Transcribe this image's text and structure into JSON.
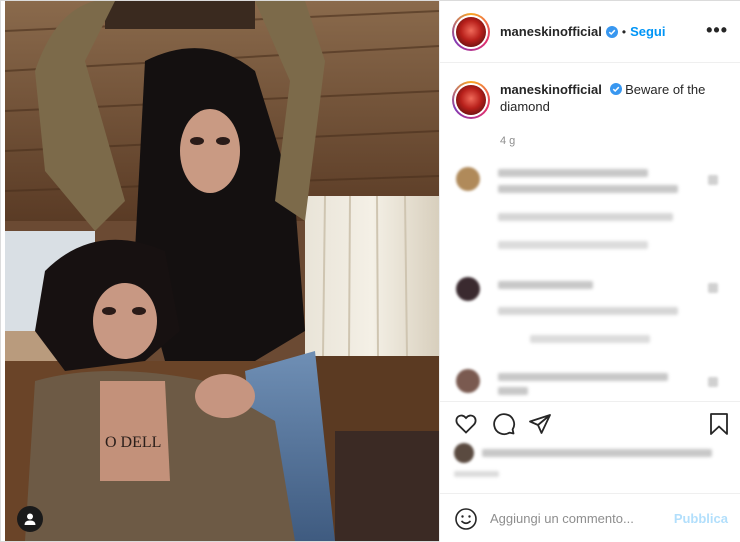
{
  "post": {
    "username": "maneskinofficial",
    "follow_label": "Segui",
    "more_label": "•••",
    "separator": "•"
  },
  "caption": {
    "username": "maneskinofficial",
    "text": "Beware of the diamond",
    "time": "4 g"
  },
  "comment_box": {
    "placeholder": "Aggiungi un commento...",
    "publish_label": "Pubblica"
  },
  "photo": {
    "tattoo_text": "O DELL"
  },
  "icons": {
    "verified": "verified-badge-icon",
    "like": "heart-icon",
    "comment": "comment-icon",
    "share": "paper-plane-icon",
    "save": "bookmark-icon",
    "emoji": "smiley-icon",
    "user_tag": "person-icon",
    "more": "more-horizontal-icon"
  },
  "colors": {
    "link_blue": "#0095f6",
    "publish_disabled": "#b2dffc",
    "muted_text": "#8e8e8e",
    "text": "#262626",
    "border": "#efefef"
  }
}
